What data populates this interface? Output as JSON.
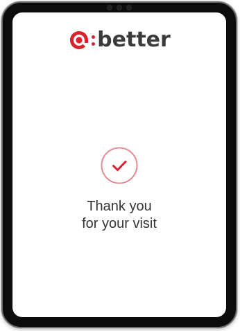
{
  "device": {
    "frame_color": "#0c0c0c"
  },
  "logo": {
    "text": "better",
    "mark_icon": "at-sign-logo-icon",
    "brand_color": "#d6232f"
  },
  "status": {
    "icon": "checkmark-circle-icon",
    "accent_color": "#d6232f",
    "line1": "Thank you",
    "line2": "for your visit"
  }
}
